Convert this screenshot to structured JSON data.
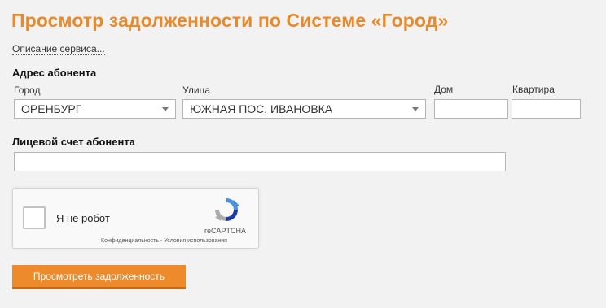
{
  "page": {
    "title": "Просмотр задолженности по Системе «Город»",
    "description_link": "Описание сервиса..."
  },
  "address": {
    "heading": "Адрес абонента",
    "city": {
      "label": "Город",
      "value": "ОРЕНБУРГ"
    },
    "street": {
      "label": "Улица",
      "value": "ЮЖНАЯ ПОС. ИВАНОВКА"
    },
    "house": {
      "label": "Дом",
      "value": ""
    },
    "apartment": {
      "label": "Квартира",
      "value": ""
    }
  },
  "account": {
    "heading": "Лицевой счет абонента",
    "value": ""
  },
  "captcha": {
    "label": "Я не робот",
    "brand": "reCAPTCHA",
    "footer": "Конфиденциальность - Условия использования"
  },
  "submit": {
    "label": "Просмотреть задолженность"
  },
  "colors": {
    "accent": "#e8892a",
    "button": "#ec8a2c",
    "background": "#f2f2f2"
  }
}
